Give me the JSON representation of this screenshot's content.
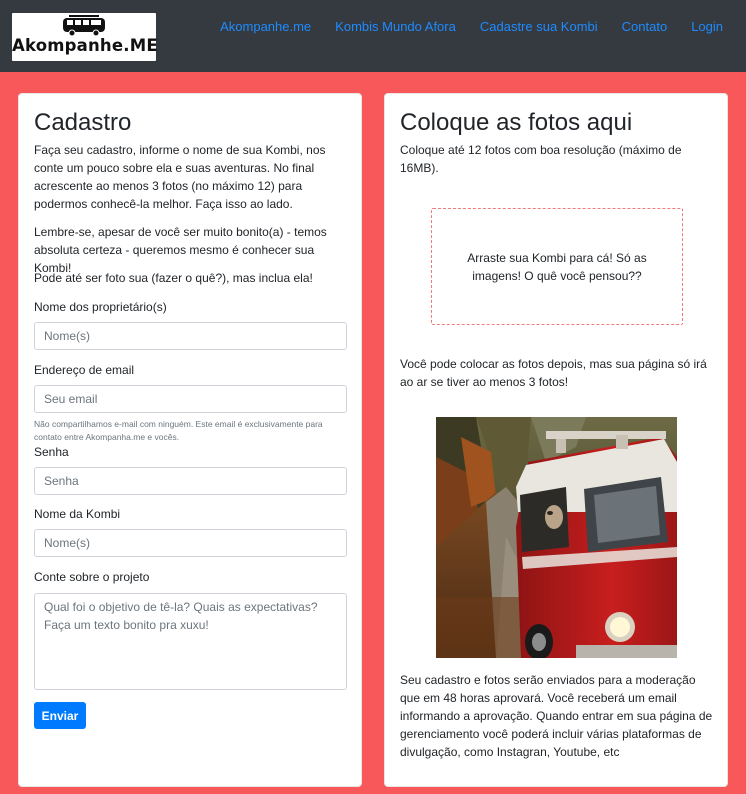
{
  "navbar": {
    "brand": "Akompanhe.ME",
    "links": [
      "Akompanhe.me",
      "Kombis Mundo Afora",
      "Cadastre sua Kombi",
      "Contato",
      "Login"
    ]
  },
  "left": {
    "title": "Cadastro",
    "intro": "Faça seu cadastro, informe o nome de sua Kombi, nos conte um pouco sobre ela e suas aventuras. No final acrescente ao menos 3 fotos (no máximo 12) para podermos conhecê-la melhor. Faça isso ao lado.",
    "reminder": "Lembre-se, apesar de você ser muito bonito(a) - temos absoluta certeza - queremos mesmo é conhecer sua Kombi!",
    "selfie_note": "Pode até ser foto sua (fazer o quê?), mas inclua ela!",
    "owners_label": "Nome dos proprietário(s)",
    "owners_placeholder": "Nome(s)",
    "email_label": "Endereço de email",
    "email_placeholder": "Seu email",
    "email_help": "Não compartilhamos e-mail com ninguém. Este email é exclusivamente para contato entre Akompanha.me e vocês.",
    "password_label": "Senha",
    "password_placeholder": "Senha",
    "kombi_label": "Nome da Kombi",
    "kombi_placeholder": "Nome(s)",
    "project_label": "Conte sobre o projeto",
    "project_placeholder": "Qual foi o objetivo de tê-la? Quais as expectativas?\nFaça um texto bonito pra xuxu!",
    "submit": "Enviar"
  },
  "right": {
    "title": "Coloque as fotos aqui",
    "subtitle": "Coloque até 12 fotos com boa resolução (máximo de 16MB).",
    "dropzone": "Arraste sua Kombi para cá! Só as imagens! O quê você pensou??",
    "later_note": "Você pode colocar as fotos depois, mas sua página só irá ao ar se tiver ao menos 3 fotos!",
    "moderation_note": "Seu cadastro e fotos serão enviados para a moderação que em 48 horas aprovará. Você receberá um email informando a aprovação. Quando entrar em sua página de gerenciamento você poderá incluir várias plataformas de divulgação, como Instagran, Youtube, etc"
  },
  "colors": {
    "background": "#f8585a",
    "navbar": "#343a40",
    "link": "#1f8bff",
    "button": "#007bff"
  }
}
